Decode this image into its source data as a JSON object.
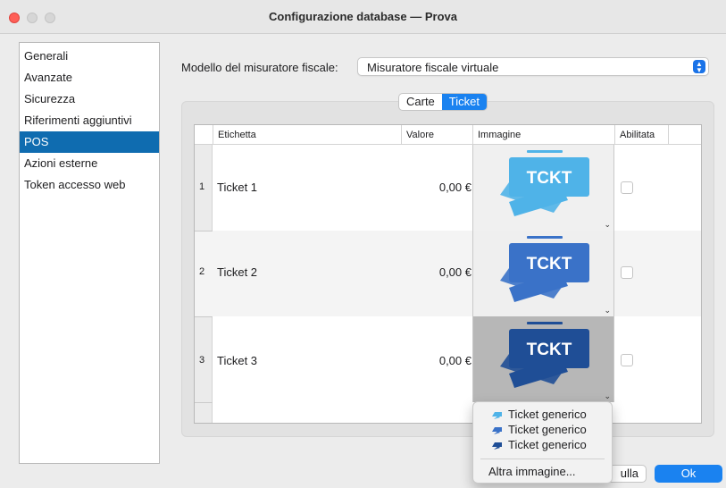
{
  "window": {
    "title": "Configurazione database — Prova"
  },
  "sidebar": {
    "items": [
      {
        "label": "Generali"
      },
      {
        "label": "Avanzate"
      },
      {
        "label": "Sicurezza"
      },
      {
        "label": "Riferimenti aggiuntivi"
      },
      {
        "label": "POS",
        "selected": true
      },
      {
        "label": "Azioni esterne"
      },
      {
        "label": "Token accesso web"
      }
    ]
  },
  "model": {
    "label": "Modello del misuratore fiscale:",
    "value": "Misuratore fiscale virtuale"
  },
  "tabs": [
    {
      "label": "Carte",
      "active": false
    },
    {
      "label": "Ticket",
      "active": true
    }
  ],
  "table": {
    "headers": {
      "label": "Etichetta",
      "value": "Valore",
      "image": "Immagine",
      "enabled": "Abilitata"
    },
    "rows": [
      {
        "num": "1",
        "label": "Ticket 1",
        "value": "0,00 €",
        "image_text": "TCKT",
        "image_color": "#4fb3e8",
        "enabled": false
      },
      {
        "num": "2",
        "label": "Ticket 2",
        "value": "0,00 €",
        "image_text": "TCKT",
        "image_color": "#3a72c8",
        "enabled": false
      },
      {
        "num": "3",
        "label": "Ticket 3",
        "value": "0,00 €",
        "image_text": "TCKT",
        "image_color": "#1f4e96",
        "enabled": false
      }
    ]
  },
  "menu": {
    "items": [
      {
        "label": "Ticket generico",
        "icon": "ticket-light-icon",
        "color": "#4fb3e8"
      },
      {
        "label": "Ticket generico",
        "icon": "ticket-medium-icon",
        "color": "#3a72c8"
      },
      {
        "label": "Ticket generico",
        "icon": "ticket-dark-icon",
        "color": "#1f4e96"
      }
    ],
    "other": "Altra immagine..."
  },
  "buttons": {
    "cancel": "ulla",
    "ok": "Ok"
  },
  "colors": {
    "accent": "#1a82f0",
    "selection": "#0f6cb0"
  }
}
